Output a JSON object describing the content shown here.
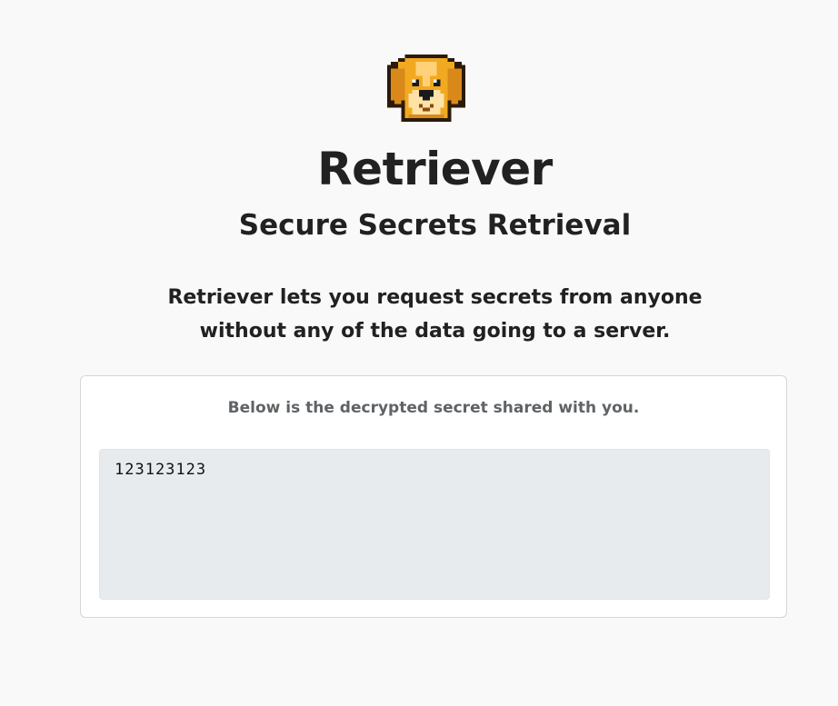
{
  "header": {
    "logo_icon": "golden-retriever-pixel-icon",
    "title": "Retriever",
    "subtitle": "Secure Secrets Retrieval",
    "description_lines": [
      "Retriever lets you request secrets from anyone",
      "without any of the data going to a server."
    ]
  },
  "card": {
    "label": "Below is the decrypted secret shared with you.",
    "secret_value": "123123123"
  },
  "colors": {
    "background": "#f9f9f9",
    "card_background": "#ffffff",
    "secret_box_background": "#e8ebee",
    "text_primary": "#212121",
    "text_muted": "#5f6366",
    "logo_gold": "#f2a922"
  }
}
